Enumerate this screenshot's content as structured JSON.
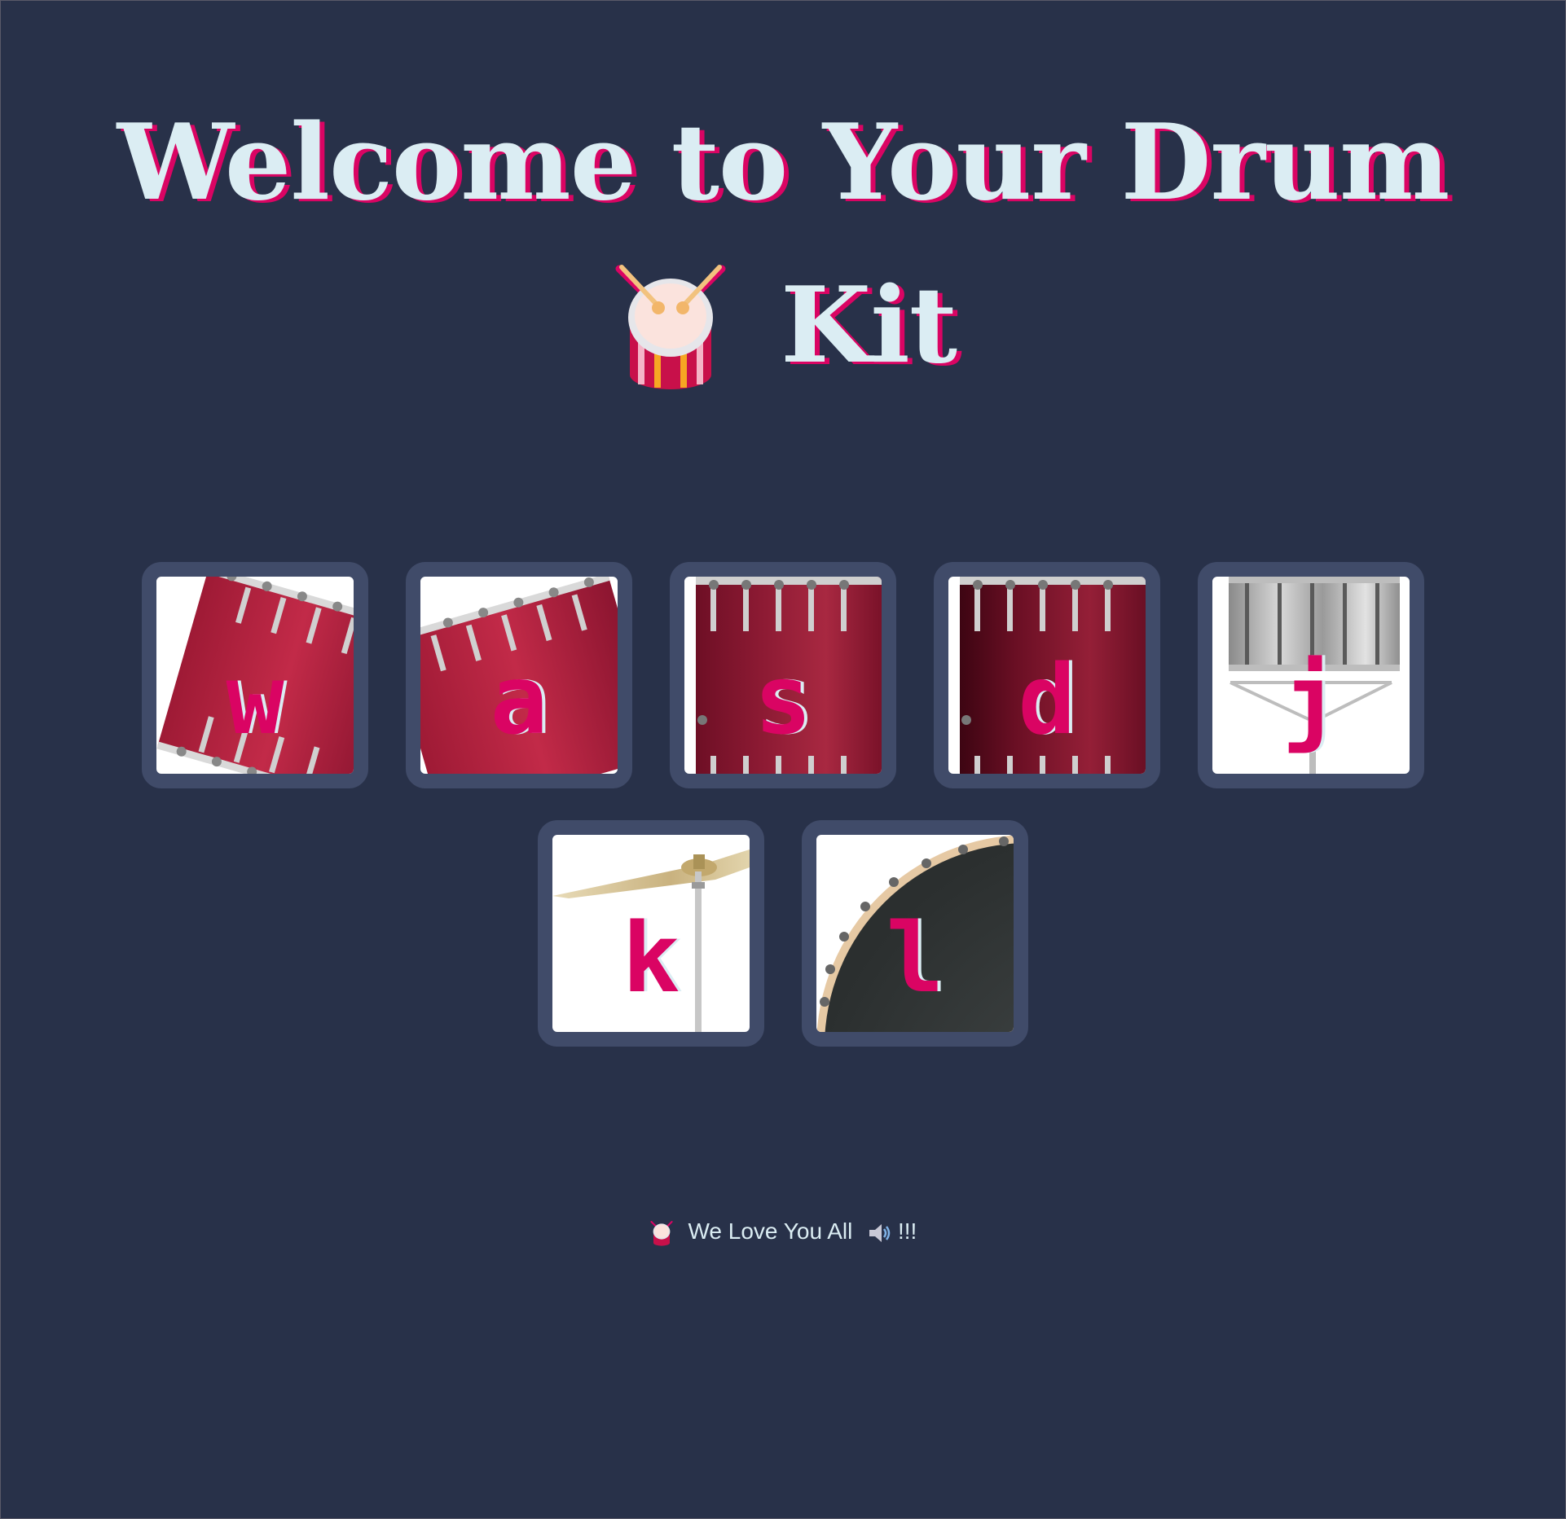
{
  "page": {
    "title_line1": "Welcome to Your Drum",
    "title_line2": "Kit",
    "title_icon": "drum-icon",
    "colors": {
      "background": "#283149",
      "tile_border": "#404b69",
      "title_text": "#dbedf3",
      "accent": "#da0463"
    }
  },
  "drums": {
    "row1": [
      {
        "key": "w",
        "instrument": "tom-1",
        "icon": "tom-drum-icon"
      },
      {
        "key": "a",
        "instrument": "tom-2",
        "icon": "tom-drum-icon"
      },
      {
        "key": "s",
        "instrument": "tom-3",
        "icon": "tom-drum-icon"
      },
      {
        "key": "d",
        "instrument": "tom-4",
        "icon": "tom-drum-icon"
      },
      {
        "key": "j",
        "instrument": "snare",
        "icon": "snare-drum-icon"
      }
    ],
    "row2": [
      {
        "key": "k",
        "instrument": "crash",
        "icon": "cymbal-icon"
      },
      {
        "key": "l",
        "instrument": "kick-bass",
        "icon": "bass-drum-icon"
      }
    ]
  },
  "footer": {
    "text": "We Love You All",
    "suffix": "!!!",
    "left_icon": "drum-icon",
    "right_icon": "speaker-icon"
  }
}
